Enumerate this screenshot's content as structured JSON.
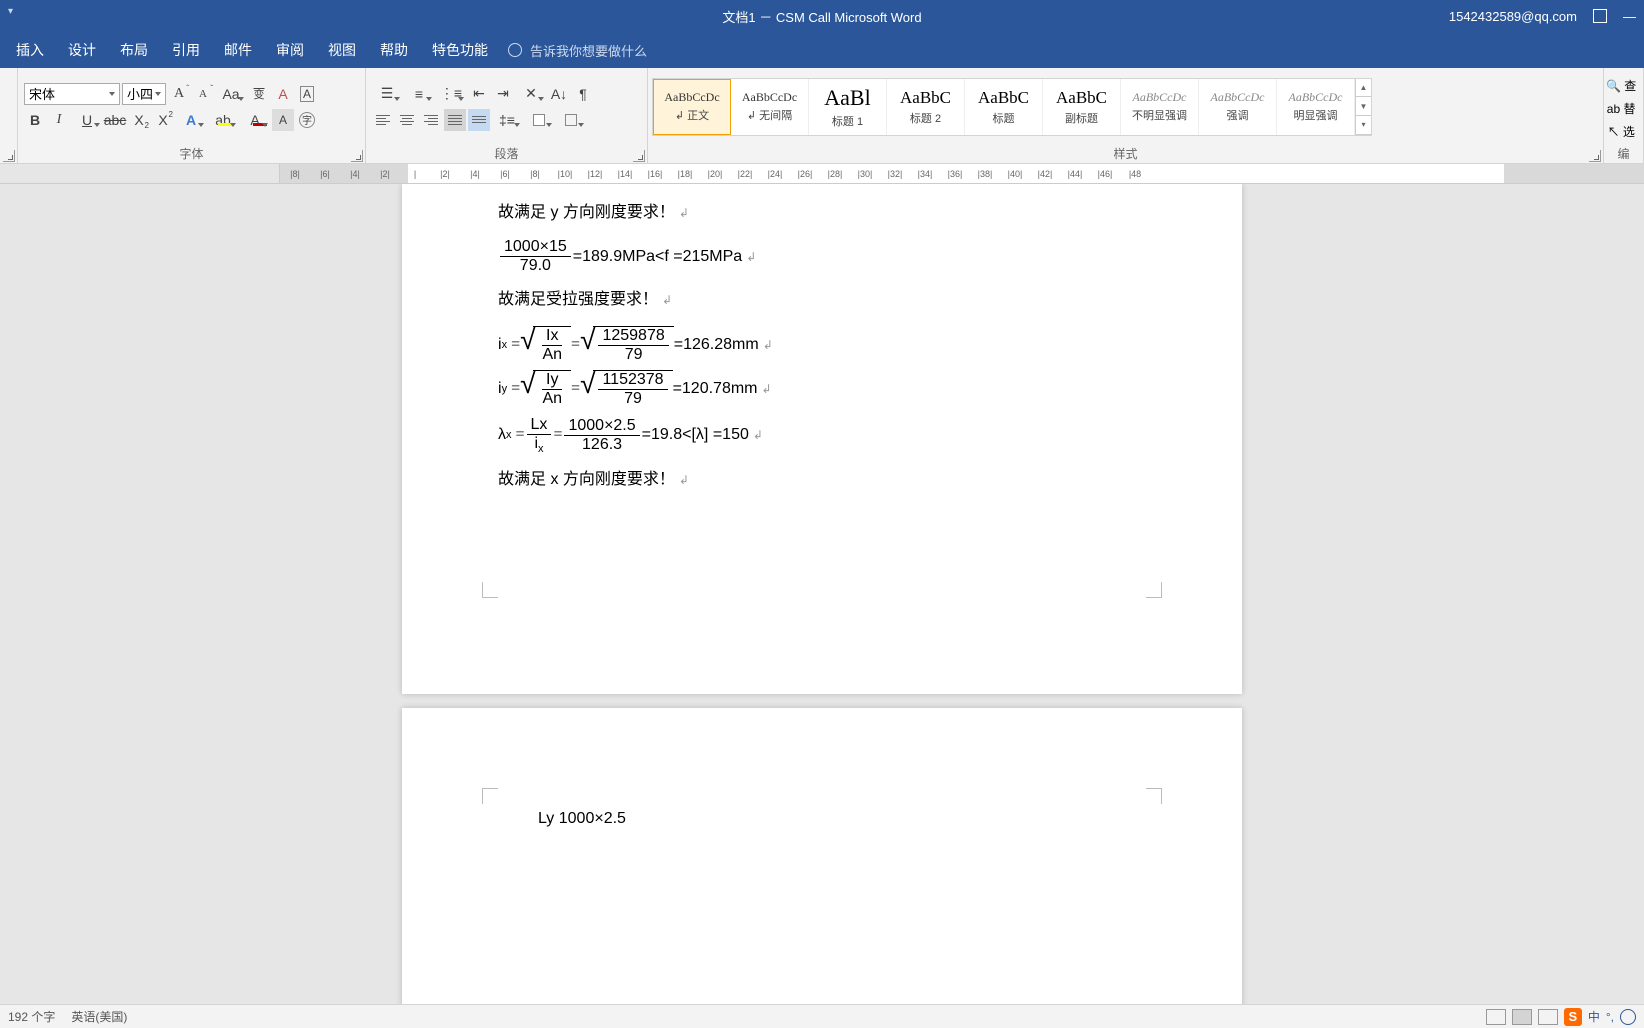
{
  "title": "文档1 － CSM Call Microsoft Word",
  "account": "1542432589@qq.com",
  "menu": [
    "插入",
    "设计",
    "布局",
    "引用",
    "邮件",
    "审阅",
    "视图",
    "帮助",
    "特色功能"
  ],
  "tell_me": "告诉我你想要做什么",
  "ribbon": {
    "font_group_label": "字体",
    "para_group_label": "段落",
    "styles_group_label": "样式",
    "edit_group_label": "编",
    "font_name": "宋体",
    "font_size": "小四",
    "find_hint": "查",
    "replace_hint": "替",
    "select_hint": "选"
  },
  "styles": [
    {
      "preview": "AaBbCcDc",
      "name": "↲ 正文",
      "size": "12px"
    },
    {
      "preview": "AaBbCcDc",
      "name": "↲ 无间隔",
      "size": "12px"
    },
    {
      "preview": "AaBl",
      "name": "标题 1",
      "size": "22px",
      "color": "#000"
    },
    {
      "preview": "AaBbC",
      "name": "标题 2",
      "size": "17px",
      "color": "#000"
    },
    {
      "preview": "AaBbC",
      "name": "标题",
      "size": "17px",
      "color": "#000"
    },
    {
      "preview": "AaBbC",
      "name": "副标题",
      "size": "17px",
      "color": "#000"
    },
    {
      "preview": "AaBbCcDc",
      "name": "不明显强调",
      "size": "12px",
      "italic": true,
      "color": "#888"
    },
    {
      "preview": "AaBbCcDc",
      "name": "强调",
      "size": "12px",
      "italic": true,
      "color": "#888"
    },
    {
      "preview": "AaBbCcDc",
      "name": "明显强调",
      "size": "12px",
      "italic": true,
      "color": "#888"
    }
  ],
  "ruler_ticks": [
    "|8|",
    "|6|",
    "|4|",
    "|2|",
    "|",
    "|2|",
    "|4|",
    "|6|",
    "|8|",
    "|10|",
    "|12|",
    "|14|",
    "|16|",
    "|18|",
    "|20|",
    "|22|",
    "|24|",
    "|26|",
    "|28|",
    "|30|",
    "|32|",
    "|34|",
    "|36|",
    "|38|",
    "|40|",
    "|42|",
    "|44|",
    "|46|",
    "|48"
  ],
  "doc": {
    "l1": "故满足 y 方向刚度要求！",
    "eq1": {
      "num": "1000×15",
      "den": "79.0",
      "rhs": "=189.9MPa<f  =215MPa"
    },
    "l2": "故满足受拉强度要求！",
    "eq2": {
      "lhs": "i",
      "sub": "x",
      "f1n": "Ix",
      "f1d": "An",
      "f2n": "1259878",
      "f2d": "79",
      "rhs": "=126.28mm"
    },
    "eq3": {
      "lhs": "i",
      "sub": "y",
      "f1n": "Iy",
      "f1d": "An",
      "f2n": "1152378",
      "f2d": "79",
      "rhs": "=120.78mm"
    },
    "eq4": {
      "lhs": "λ",
      "sub": "x",
      "f1n": "Lx",
      "f1d": "i",
      "f1dsub": "x",
      "f2n": "1000×2.5",
      "f2d": "126.3",
      "rhs": "=19.8<[λ]  =150"
    },
    "l3": "故满足 x 方向刚度要求！",
    "eq5_partial": "Ly   1000×2.5"
  },
  "status": {
    "word_count": "192 个字",
    "language": "英语(美国)",
    "ime": "S",
    "ime_lang": "中"
  }
}
